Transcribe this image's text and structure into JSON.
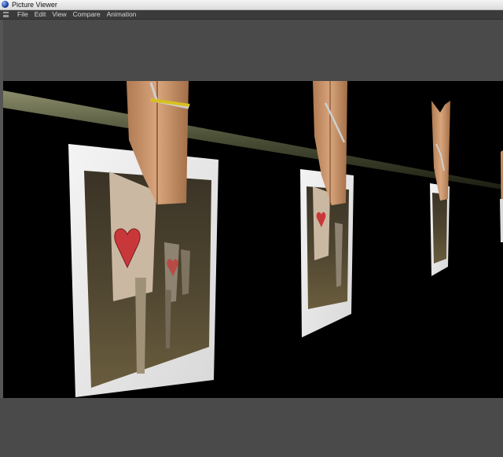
{
  "window": {
    "title": "Picture Viewer",
    "icon": "app-orb-icon"
  },
  "menu": {
    "items": [
      {
        "label": "File"
      },
      {
        "label": "Edit"
      },
      {
        "label": "View"
      },
      {
        "label": "Compare"
      },
      {
        "label": "Animation"
      }
    ]
  },
  "viewer": {
    "image_description_visible": false,
    "colors": {
      "background": "#000000",
      "panel": "#4a4a4a",
      "menubar": "#3b3b3b"
    }
  }
}
